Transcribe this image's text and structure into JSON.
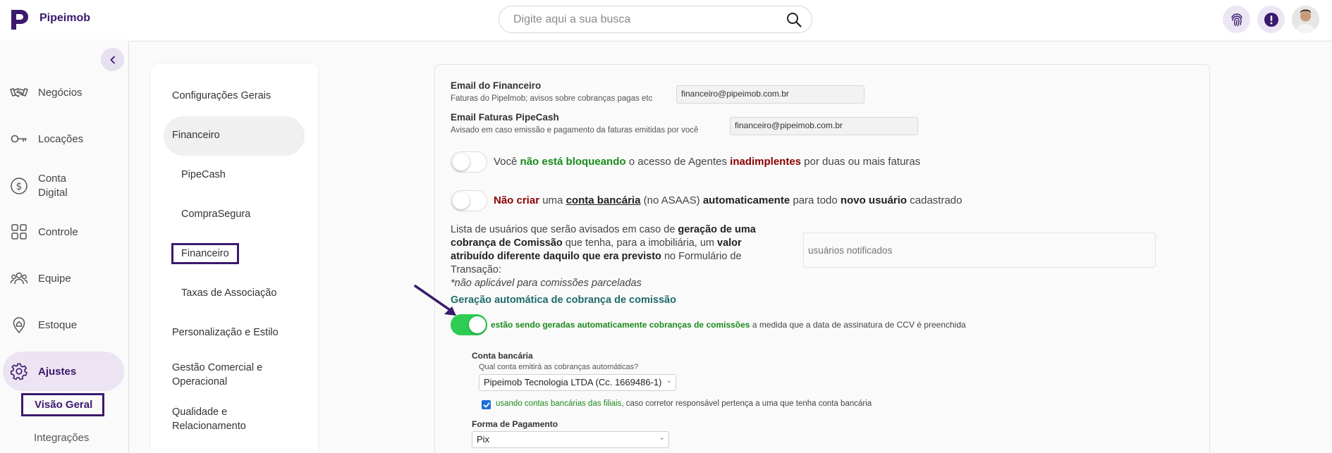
{
  "app": {
    "name": "Pipeimob"
  },
  "search": {
    "placeholder": "Digite aqui a sua busca"
  },
  "sidebar": {
    "items": [
      {
        "label": "Negócios"
      },
      {
        "label": "Locações"
      },
      {
        "label": "Conta Digital"
      },
      {
        "label": "Controle"
      },
      {
        "label": "Equipe"
      },
      {
        "label": "Estoque"
      },
      {
        "label": "Ajustes"
      }
    ],
    "subitems": [
      {
        "label": "Visão Geral"
      },
      {
        "label": "Integrações"
      }
    ]
  },
  "settings_menu": {
    "items": [
      {
        "label": "Configurações Gerais"
      },
      {
        "label": "Financeiro"
      },
      {
        "label": "PipeCash"
      },
      {
        "label": "CompraSegura"
      },
      {
        "label": "Financeiro"
      },
      {
        "label": "Taxas de Associação"
      },
      {
        "label": "Personalização e Estilo"
      },
      {
        "label": "Gestão Comercial e Operacional"
      },
      {
        "label": "Qualidade e Relacionamento"
      }
    ]
  },
  "form": {
    "email_financeiro": {
      "label": "Email do Financeiro",
      "hint": "Faturas do Pipelmob; avisos sobre cobranças pagas etc",
      "value": "financeiro@pipeimob.com.br"
    },
    "email_faturas": {
      "label": "Email Faturas PipeCash",
      "hint": "Avisado em caso emissão e pagamento da faturas emitidas por você",
      "value": "financeiro@pipeimob.com.br"
    },
    "toggle_bloqueio": {
      "state": "off",
      "t1": "Você ",
      "t2": "não está bloqueando",
      "t3": " o acesso de Agentes ",
      "t4": "inadimplentes",
      "t5": " por duas ou mais faturas"
    },
    "toggle_conta": {
      "state": "off",
      "t1": "Não criar",
      "t2": " uma ",
      "t3": "conta bancária",
      "t4": " (no ASAAS) ",
      "t5": "automaticamente",
      "t6": " para todo ",
      "t7": "novo usuário",
      "t8": " cadastrado"
    },
    "lista_usuarios": {
      "t1": "Lista de usuários que serão avisados em caso de ",
      "t2": "geração de uma cobrança de Comissão",
      "t3": " que tenha, para a imobiliária, um ",
      "t4": "valor atribuído diferente daquilo que era previsto",
      "t5": " no Formulário de Transação:",
      "t6": "*não aplicável para comissões parceladas",
      "placeholder": "usuários notificados"
    },
    "geracao": {
      "title": "Geração automática de cobrança de comissão",
      "state": "on",
      "t1": "estão sendo geradas automaticamente cobranças de comissões",
      "t2": " a medida que a data de assinatura de CCV é preenchida"
    },
    "conta_bancaria": {
      "label": "Conta bancária",
      "hint": "Qual conta emitirá as cobranças automáticas?",
      "value": "Pipeimob Tecnologia LTDA (Cc. 1669486-1)"
    },
    "filiais": {
      "checked": true,
      "t1": "usando contas bancárias das filiais",
      "t2": ", caso corretor responsável pertença a uma que tenha conta bancária"
    },
    "forma_pagamento": {
      "label": "Forma de Pagamento",
      "value": "Pix"
    }
  },
  "colors": {
    "brand": "#3b1a6e",
    "toggle_on": "#2ecc52",
    "green_text": "#1a8a1a",
    "red_text": "#8b0000",
    "section_title": "#1f6b6b"
  }
}
